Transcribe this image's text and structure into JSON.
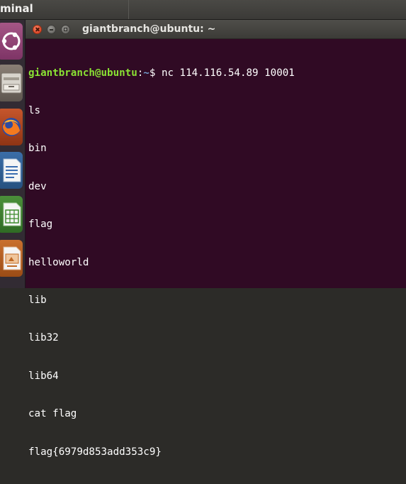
{
  "top_panel": {
    "app_name": "minal"
  },
  "window": {
    "title": "giantbranch@ubuntu: ~",
    "prompt": {
      "user_host": "giantbranch@ubuntu",
      "colon": ":",
      "path": "~",
      "symbol": "$ "
    },
    "command": "nc 114.116.54.89 10001",
    "output_lines": [
      "ls",
      "bin",
      "dev",
      "flag",
      "helloworld",
      "lib",
      "lib32",
      "lib64",
      "cat flag",
      "flag{6979d853add353c9}"
    ]
  },
  "launcher": {
    "items": [
      "ubuntu-dash-icon",
      "files-icon",
      "firefox-icon",
      "writer-icon",
      "calc-icon",
      "impress-icon"
    ]
  },
  "colors": {
    "terminal_bg": "#300a24",
    "prompt_user": "#8ae234",
    "prompt_path": "#729fcf",
    "text": "#ffffff"
  }
}
